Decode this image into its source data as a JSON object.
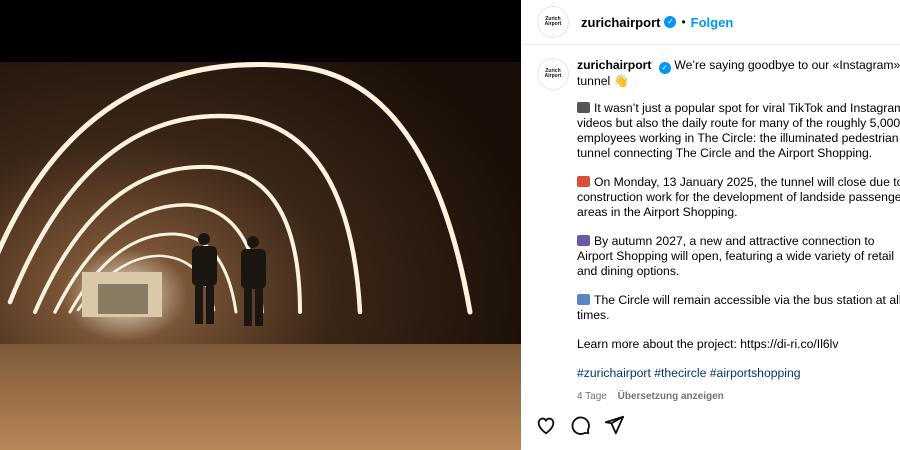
{
  "header": {
    "avatar_line1": "Zurich",
    "avatar_line2": "Airport",
    "username": "zurichairport",
    "follow_label": "Folgen",
    "separator": "•"
  },
  "caption": {
    "username": "zurichairport",
    "intro": "We’re saying goodbye to our «Instagram» tunnel",
    "p1": "It wasn’t just a popular spot for viral TikTok and Instagram videos but also the daily route for many of the roughly 5,000 employees working in The Circle: the illuminated pedestrian tunnel connecting The Circle and the Airport Shopping.",
    "p2": "On Monday, 13 January 2025, the tunnel will close due to construction work for the development of landside passenger areas in the Airport Shopping.",
    "p3": "By autumn 2027, a new and attractive connection to Airport Shopping will open, featuring a wide variety of retail and dining options.",
    "p4": "The Circle will remain accessible via the bus station at all times.",
    "p5": "Learn more about the project: https://di-ri.co/Il6lv",
    "hashtags": "#zurichairport #thecircle #airportshopping"
  },
  "meta": {
    "age": "4 Tage",
    "translate_label": "Übersetzung anzeigen"
  },
  "icons": [
    "verified-icon",
    "like-icon",
    "comment-icon",
    "share-icon"
  ],
  "colors": {
    "accent": "#0095f6",
    "hashtag": "#00376b",
    "muted": "#737373"
  }
}
